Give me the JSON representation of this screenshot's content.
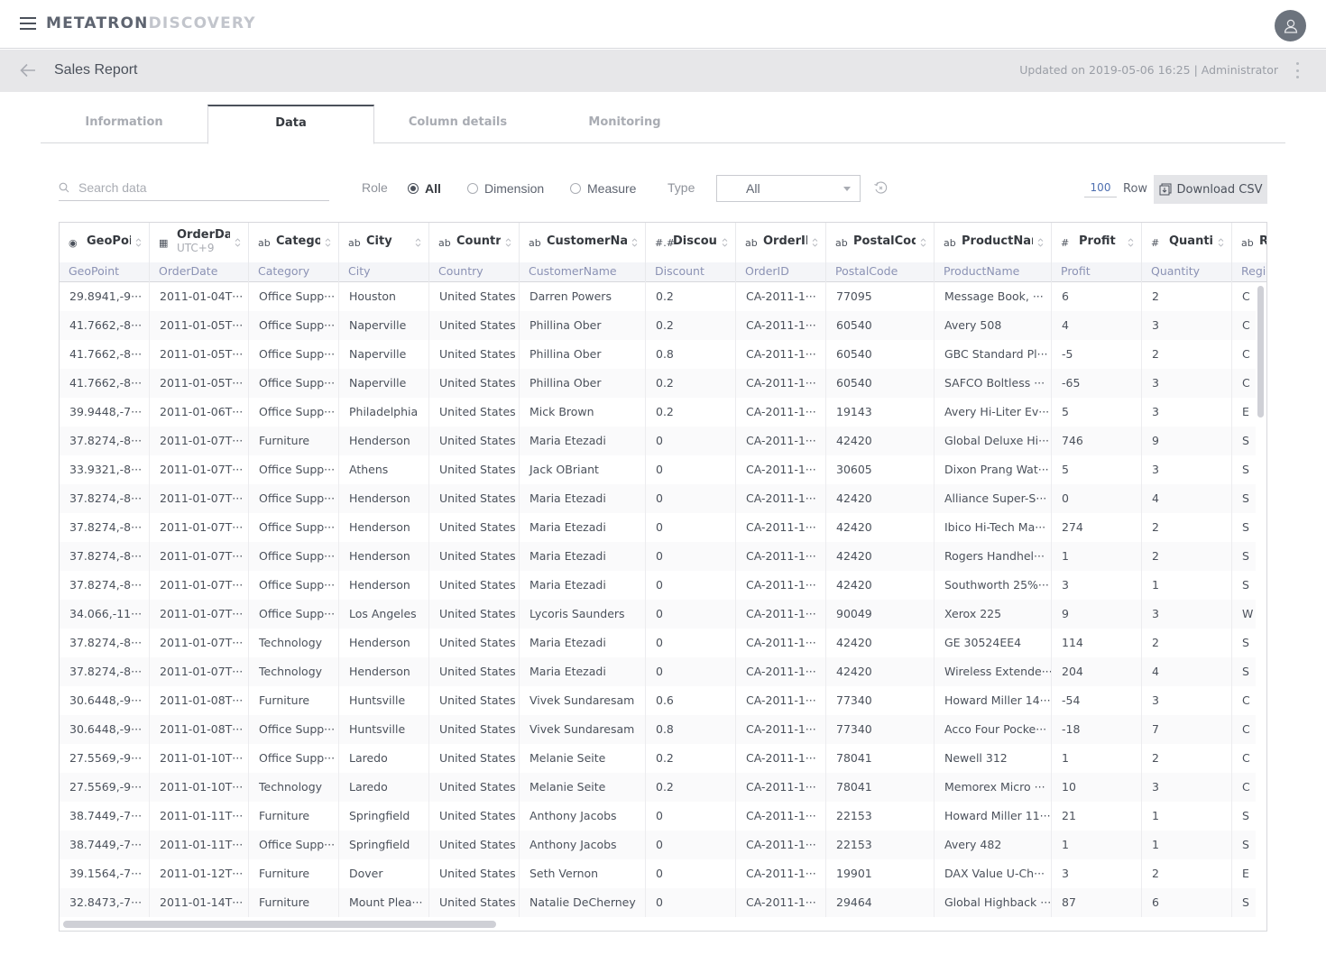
{
  "app": {
    "logo_primary": "METATRON",
    "logo_secondary": "DISCOVERY"
  },
  "header": {
    "title": "Sales Report",
    "updated": "Updated on 2019-05-06 16:25 | Administrator"
  },
  "tabs": [
    {
      "label": "Information",
      "active": false
    },
    {
      "label": "Data",
      "active": true
    },
    {
      "label": "Column details",
      "active": false
    },
    {
      "label": "Monitoring",
      "active": false
    }
  ],
  "filters": {
    "search_placeholder": "Search data",
    "search_value": "",
    "role_label": "Role",
    "role_options": [
      "All",
      "Dimension",
      "Measure"
    ],
    "role_selected": "All",
    "type_label": "Type",
    "type_selected": "All",
    "row_count": "100",
    "row_label": "Row",
    "download_label": "Download CSV"
  },
  "grid": {
    "columns": [
      {
        "key": "GeoPoint",
        "header": "GeoPoin",
        "type_icon": "geo-icon",
        "type_glyph": "◉",
        "subtitle": "",
        "alias": "GeoPoint"
      },
      {
        "key": "OrderDate",
        "header": "OrderDate",
        "type_icon": "calendar-icon",
        "type_glyph": "▦",
        "subtitle": "UTC+9",
        "alias": "OrderDate"
      },
      {
        "key": "Category",
        "header": "Category",
        "type_icon": "string-icon",
        "type_glyph": "ab",
        "subtitle": "",
        "alias": "Category"
      },
      {
        "key": "City",
        "header": "City",
        "type_icon": "string-icon",
        "type_glyph": "ab",
        "subtitle": "",
        "alias": "City"
      },
      {
        "key": "Country",
        "header": "Country",
        "type_icon": "string-icon",
        "type_glyph": "ab",
        "subtitle": "",
        "alias": "Country"
      },
      {
        "key": "CustomerName",
        "header": "CustomerName",
        "type_icon": "string-icon",
        "type_glyph": "ab",
        "subtitle": "",
        "alias": "CustomerName"
      },
      {
        "key": "Discount",
        "header": "Discount",
        "type_icon": "decimal-icon",
        "type_glyph": "#.#",
        "subtitle": "",
        "alias": "Discount"
      },
      {
        "key": "OrderID",
        "header": "OrderID",
        "type_icon": "string-icon",
        "type_glyph": "ab",
        "subtitle": "",
        "alias": "OrderID"
      },
      {
        "key": "PostalCode",
        "header": "PostalCode",
        "type_icon": "string-icon",
        "type_glyph": "ab",
        "subtitle": "",
        "alias": "PostalCode"
      },
      {
        "key": "ProductName",
        "header": "ProductName",
        "type_icon": "string-icon",
        "type_glyph": "ab",
        "subtitle": "",
        "alias": "ProductName"
      },
      {
        "key": "Profit",
        "header": "Profit",
        "type_icon": "integer-icon",
        "type_glyph": "#",
        "subtitle": "",
        "alias": "Profit"
      },
      {
        "key": "Quantity",
        "header": "Quantity",
        "type_icon": "integer-icon",
        "type_glyph": "#",
        "subtitle": "",
        "alias": "Quantity"
      },
      {
        "key": "Region",
        "header": "R",
        "type_icon": "string-icon",
        "type_glyph": "ab",
        "subtitle": "",
        "alias": "Regio"
      }
    ],
    "rows": [
      [
        "29.8941,-9···",
        "2011-01-04T···",
        "Office Supp···",
        "Houston",
        "United States",
        "Darren Powers",
        "0.2",
        "CA-2011-1···",
        "77095",
        "Message Book, ···",
        "6",
        "2",
        "C"
      ],
      [
        "41.7662,-8···",
        "2011-01-05T···",
        "Office Supp···",
        "Naperville",
        "United States",
        "Phillina Ober",
        "0.2",
        "CA-2011-1···",
        "60540",
        "Avery 508",
        "4",
        "3",
        "C"
      ],
      [
        "41.7662,-8···",
        "2011-01-05T···",
        "Office Supp···",
        "Naperville",
        "United States",
        "Phillina Ober",
        "0.8",
        "CA-2011-1···",
        "60540",
        "GBC Standard Pl···",
        "-5",
        "2",
        "C"
      ],
      [
        "41.7662,-8···",
        "2011-01-05T···",
        "Office Supp···",
        "Naperville",
        "United States",
        "Phillina Ober",
        "0.2",
        "CA-2011-1···",
        "60540",
        "SAFCO Boltless ···",
        "-65",
        "3",
        "C"
      ],
      [
        "39.9448,-7···",
        "2011-01-06T···",
        "Office Supp···",
        "Philadelphia",
        "United States",
        "Mick Brown",
        "0.2",
        "CA-2011-1···",
        "19143",
        "Avery Hi-Liter Ev···",
        "5",
        "3",
        "E"
      ],
      [
        "37.8274,-8···",
        "2011-01-07T···",
        "Furniture",
        "Henderson",
        "United States",
        "Maria Etezadi",
        "0",
        "CA-2011-1···",
        "42420",
        "Global Deluxe Hi···",
        "746",
        "9",
        "S"
      ],
      [
        "33.9321,-8···",
        "2011-01-07T···",
        "Office Supp···",
        "Athens",
        "United States",
        "Jack OBriant",
        "0",
        "CA-2011-1···",
        "30605",
        "Dixon Prang Wat···",
        "5",
        "3",
        "S"
      ],
      [
        "37.8274,-8···",
        "2011-01-07T···",
        "Office Supp···",
        "Henderson",
        "United States",
        "Maria Etezadi",
        "0",
        "CA-2011-1···",
        "42420",
        "Alliance Super-S···",
        "0",
        "4",
        "S"
      ],
      [
        "37.8274,-8···",
        "2011-01-07T···",
        "Office Supp···",
        "Henderson",
        "United States",
        "Maria Etezadi",
        "0",
        "CA-2011-1···",
        "42420",
        "Ibico Hi-Tech Ma···",
        "274",
        "2",
        "S"
      ],
      [
        "37.8274,-8···",
        "2011-01-07T···",
        "Office Supp···",
        "Henderson",
        "United States",
        "Maria Etezadi",
        "0",
        "CA-2011-1···",
        "42420",
        "Rogers Handhel···",
        "1",
        "2",
        "S"
      ],
      [
        "37.8274,-8···",
        "2011-01-07T···",
        "Office Supp···",
        "Henderson",
        "United States",
        "Maria Etezadi",
        "0",
        "CA-2011-1···",
        "42420",
        "Southworth 25%···",
        "3",
        "1",
        "S"
      ],
      [
        "34.066,-11···",
        "2011-01-07T···",
        "Office Supp···",
        "Los Angeles",
        "United States",
        "Lycoris Saunders",
        "0",
        "CA-2011-1···",
        "90049",
        "Xerox 225",
        "9",
        "3",
        "W"
      ],
      [
        "37.8274,-8···",
        "2011-01-07T···",
        "Technology",
        "Henderson",
        "United States",
        "Maria Etezadi",
        "0",
        "CA-2011-1···",
        "42420",
        "GE 30524EE4",
        "114",
        "2",
        "S"
      ],
      [
        "37.8274,-8···",
        "2011-01-07T···",
        "Technology",
        "Henderson",
        "United States",
        "Maria Etezadi",
        "0",
        "CA-2011-1···",
        "42420",
        "Wireless Extende···",
        "204",
        "4",
        "S"
      ],
      [
        "30.6448,-9···",
        "2011-01-08T···",
        "Furniture",
        "Huntsville",
        "United States",
        "Vivek Sundaresam",
        "0.6",
        "CA-2011-1···",
        "77340",
        "Howard Miller 14···",
        "-54",
        "3",
        "C"
      ],
      [
        "30.6448,-9···",
        "2011-01-08T···",
        "Office Supp···",
        "Huntsville",
        "United States",
        "Vivek Sundaresam",
        "0.8",
        "CA-2011-1···",
        "77340",
        "Acco Four Pocke···",
        "-18",
        "7",
        "C"
      ],
      [
        "27.5569,-9···",
        "2011-01-10T···",
        "Office Supp···",
        "Laredo",
        "United States",
        "Melanie Seite",
        "0.2",
        "CA-2011-1···",
        "78041",
        "Newell 312",
        "1",
        "2",
        "C"
      ],
      [
        "27.5569,-9···",
        "2011-01-10T···",
        "Technology",
        "Laredo",
        "United States",
        "Melanie Seite",
        "0.2",
        "CA-2011-1···",
        "78041",
        "Memorex Micro ···",
        "10",
        "3",
        "C"
      ],
      [
        "38.7449,-7···",
        "2011-01-11T···",
        "Furniture",
        "Springfield",
        "United States",
        "Anthony Jacobs",
        "0",
        "CA-2011-1···",
        "22153",
        "Howard Miller 11···",
        "21",
        "1",
        "S"
      ],
      [
        "38.7449,-7···",
        "2011-01-11T···",
        "Office Supp···",
        "Springfield",
        "United States",
        "Anthony Jacobs",
        "0",
        "CA-2011-1···",
        "22153",
        "Avery 482",
        "1",
        "1",
        "S"
      ],
      [
        "39.1564,-7···",
        "2011-01-12T···",
        "Furniture",
        "Dover",
        "United States",
        "Seth Vernon",
        "0",
        "CA-2011-1···",
        "19901",
        "DAX Value U-Ch···",
        "3",
        "2",
        "E"
      ],
      [
        "32.8473,-7···",
        "2011-01-14T···",
        "Furniture",
        "Mount Plea···",
        "United States",
        "Natalie DeCherney",
        "0",
        "CA-2011-1···",
        "29464",
        "Global Highback ···",
        "87",
        "6",
        "S"
      ]
    ]
  }
}
